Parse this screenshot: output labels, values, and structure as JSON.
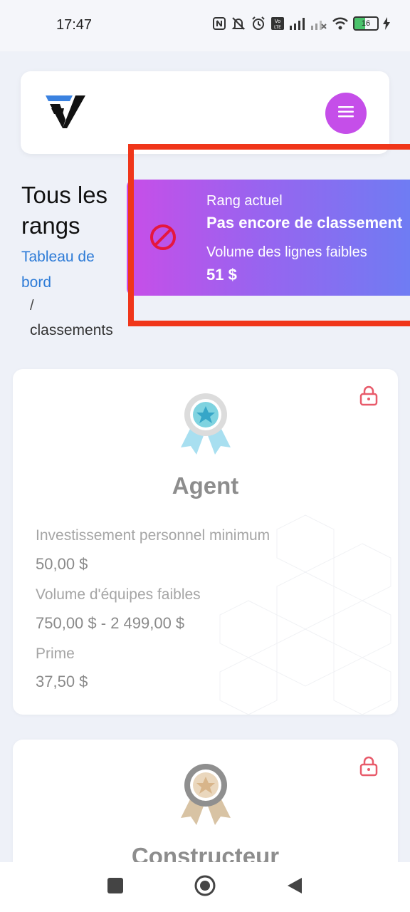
{
  "status_bar": {
    "time": "17:47",
    "icons": [
      "nfc-icon",
      "bell-off-icon",
      "alarm-icon",
      "volte-icon",
      "signal-icon",
      "signal-weak-icon",
      "wifi-icon",
      "battery-icon",
      "charging-icon"
    ],
    "battery_level": "16"
  },
  "header": {
    "logo": "brand-logo",
    "menu_icon": "hamburger-icon",
    "accent_color": "#c54ee9"
  },
  "page": {
    "title": "Tous les rangs",
    "breadcrumb": {
      "link": "Tableau de bord",
      "separator": "/",
      "current": "classements"
    }
  },
  "current_rank": {
    "icon": "no-entry-icon",
    "rank_label": "Rang actuel",
    "rank_value": "Pas encore de classement",
    "volume_label": "Volume des lignes faibles",
    "volume_value": "51 $"
  },
  "ranks": [
    {
      "name": "Agent",
      "badge_icon": "ribbon-badge-icon",
      "badge_color": "#7fd3e0",
      "locked_icon": "lock-icon",
      "fields": [
        {
          "label": "Investissement personnel minimum",
          "value": "50,00 $"
        },
        {
          "label": "Volume d'équipes faibles",
          "value": "750,00 $ - 2 499,00 $"
        },
        {
          "label": "Prime",
          "value": "37,50 $"
        }
      ]
    },
    {
      "name": "Constructeur",
      "badge_icon": "ribbon-badge-icon",
      "badge_color": "#d8b58a",
      "locked_icon": "lock-icon"
    }
  ],
  "nav_bar": {
    "recent_icon": "square-icon",
    "home_icon": "circle-home-icon",
    "back_icon": "triangle-back-icon"
  }
}
